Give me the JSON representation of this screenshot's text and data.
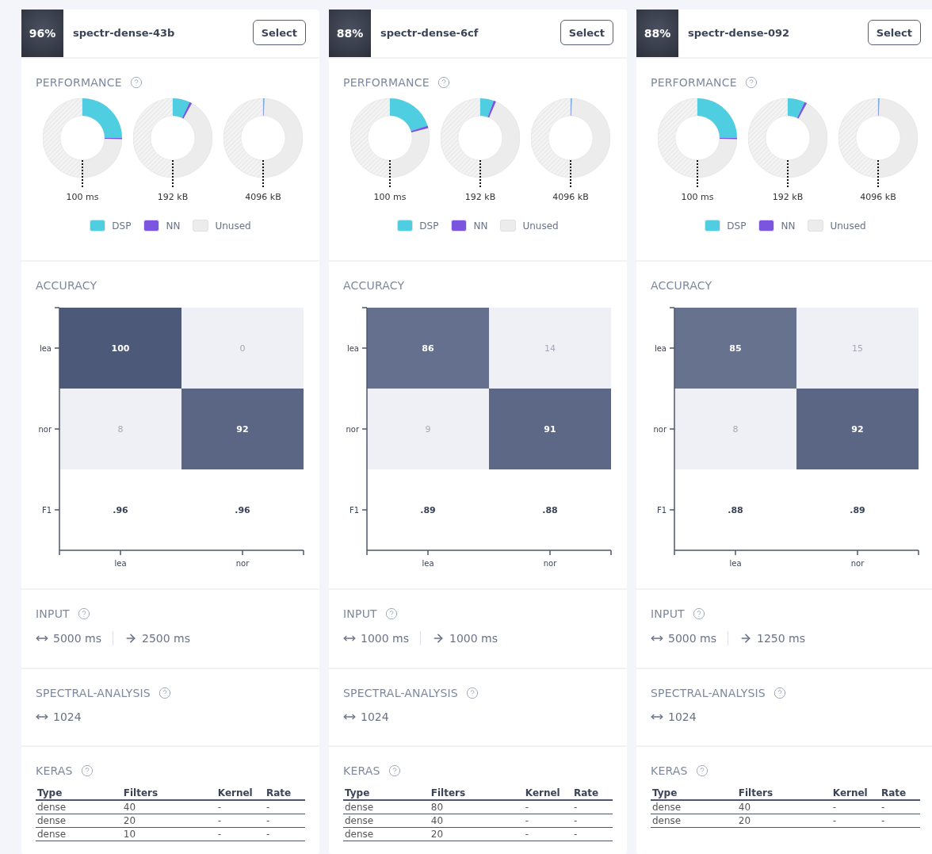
{
  "cards": [
    {
      "score": "96%",
      "name": "spectr-dense-43b",
      "select_label": "Select",
      "performance": {
        "title": "PERFORMANCE",
        "donuts": [
          {
            "label": "100 ms"
          },
          {
            "label": "192 kB"
          },
          {
            "label": "4096 kB"
          }
        ],
        "legend": [
          {
            "label": "DSP",
            "color": "#4fcde1"
          },
          {
            "label": "NN",
            "color": "#7b55e0"
          },
          {
            "label": "Unused",
            "color": "#ececec"
          }
        ]
      },
      "accuracy": {
        "title": "ACCURACY",
        "matrix": [
          {
            "label": "lea",
            "cells": [
              "100",
              "0"
            ]
          },
          {
            "label": "nor",
            "cells": [
              "8",
              "92"
            ]
          }
        ],
        "f1": {
          "label": "F1",
          "values": [
            ".96",
            ".96"
          ]
        },
        "x_labels": [
          "lea",
          "nor"
        ]
      },
      "input": {
        "title": "INPUT",
        "window": "5000 ms",
        "stride": "2500 ms"
      },
      "spectral": {
        "title": "SPECTRAL-ANALYSIS",
        "value": "1024"
      },
      "keras": {
        "title": "KERAS",
        "columns": [
          "Type",
          "Filters",
          "Kernel",
          "Rate"
        ],
        "rows": [
          [
            "dense",
            "40",
            "-",
            "-"
          ],
          [
            "dense",
            "20",
            "-",
            "-"
          ],
          [
            "dense",
            "10",
            "-",
            "-"
          ]
        ]
      }
    },
    {
      "score": "88%",
      "name": "spectr-dense-6cf",
      "select_label": "Select",
      "performance": {
        "title": "PERFORMANCE",
        "donuts": [
          {
            "label": "100 ms"
          },
          {
            "label": "192 kB"
          },
          {
            "label": "4096 kB"
          }
        ],
        "legend": [
          {
            "label": "DSP",
            "color": "#4fcde1"
          },
          {
            "label": "NN",
            "color": "#7b55e0"
          },
          {
            "label": "Unused",
            "color": "#ececec"
          }
        ]
      },
      "accuracy": {
        "title": "ACCURACY",
        "matrix": [
          {
            "label": "lea",
            "cells": [
              "86",
              "14"
            ]
          },
          {
            "label": "nor",
            "cells": [
              "9",
              "91"
            ]
          }
        ],
        "f1": {
          "label": "F1",
          "values": [
            ".89",
            ".88"
          ]
        },
        "x_labels": [
          "lea",
          "nor"
        ]
      },
      "input": {
        "title": "INPUT",
        "window": "1000 ms",
        "stride": "1000 ms"
      },
      "spectral": {
        "title": "SPECTRAL-ANALYSIS",
        "value": "1024"
      },
      "keras": {
        "title": "KERAS",
        "columns": [
          "Type",
          "Filters",
          "Kernel",
          "Rate"
        ],
        "rows": [
          [
            "dense",
            "80",
            "-",
            "-"
          ],
          [
            "dense",
            "40",
            "-",
            "-"
          ],
          [
            "dense",
            "20",
            "-",
            "-"
          ]
        ]
      }
    },
    {
      "score": "88%",
      "name": "spectr-dense-092",
      "select_label": "Select",
      "performance": {
        "title": "PERFORMANCE",
        "donuts": [
          {
            "label": "100 ms"
          },
          {
            "label": "192 kB"
          },
          {
            "label": "4096 kB"
          }
        ],
        "legend": [
          {
            "label": "DSP",
            "color": "#4fcde1"
          },
          {
            "label": "NN",
            "color": "#7b55e0"
          },
          {
            "label": "Unused",
            "color": "#ececec"
          }
        ]
      },
      "accuracy": {
        "title": "ACCURACY",
        "matrix": [
          {
            "label": "lea",
            "cells": [
              "85",
              "15"
            ]
          },
          {
            "label": "nor",
            "cells": [
              "8",
              "92"
            ]
          }
        ],
        "f1": {
          "label": "F1",
          "values": [
            ".88",
            ".89"
          ]
        },
        "x_labels": [
          "lea",
          "nor"
        ]
      },
      "input": {
        "title": "INPUT",
        "window": "5000 ms",
        "stride": "1250 ms"
      },
      "spectral": {
        "title": "SPECTRAL-ANALYSIS",
        "value": "1024"
      },
      "keras": {
        "title": "KERAS",
        "columns": [
          "Type",
          "Filters",
          "Kernel",
          "Rate"
        ],
        "rows": [
          [
            "dense",
            "40",
            "-",
            "-"
          ],
          [
            "dense",
            "20",
            "-",
            "-"
          ]
        ]
      }
    }
  ]
}
